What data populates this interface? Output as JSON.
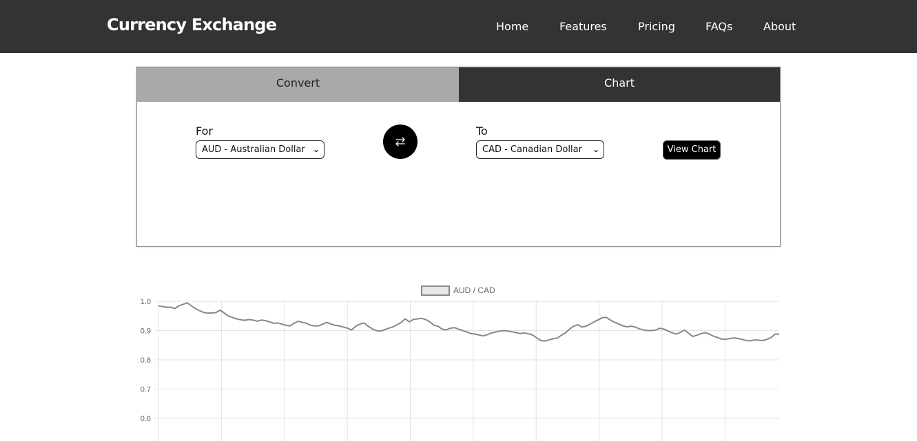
{
  "header": {
    "brand": "Currency Exchange",
    "nav": [
      {
        "label": "Home"
      },
      {
        "label": "Features"
      },
      {
        "label": "Pricing"
      },
      {
        "label": "FAQs"
      },
      {
        "label": "About"
      }
    ]
  },
  "converter": {
    "tabs": {
      "convert": "Convert",
      "chart": "Chart"
    },
    "active_tab": "Chart",
    "from_label": "For",
    "from_value": "AUD - Australian Dollar",
    "to_label": "To",
    "to_value": "CAD - Canadian Dollar",
    "view_button": "View Chart",
    "swap_icon": "swap-arrows-icon"
  },
  "colors": {
    "header_bg": "#333333",
    "tab_inactive": "#a9a9a9",
    "tab_active": "#333333",
    "line": "#888888"
  },
  "chart_data": {
    "type": "line",
    "series": [
      {
        "name": "AUD / CAD",
        "values": [
          0.985,
          0.982,
          0.98,
          0.98,
          0.975,
          0.985,
          0.99,
          0.995,
          0.985,
          0.975,
          0.968,
          0.962,
          0.96,
          0.96,
          0.962,
          0.97,
          0.96,
          0.95,
          0.945,
          0.94,
          0.937,
          0.935,
          0.938,
          0.936,
          0.932,
          0.936,
          0.934,
          0.93,
          0.925,
          0.926,
          0.922,
          0.918,
          0.916,
          0.925,
          0.932,
          0.928,
          0.925,
          0.918,
          0.916,
          0.916,
          0.922,
          0.928,
          0.922,
          0.918,
          0.916,
          0.912,
          0.908,
          0.902,
          0.915,
          0.922,
          0.926,
          0.915,
          0.906,
          0.9,
          0.898,
          0.903,
          0.908,
          0.912,
          0.92,
          0.927,
          0.94,
          0.93,
          0.938,
          0.94,
          0.942,
          0.938,
          0.93,
          0.918,
          0.915,
          0.905,
          0.902,
          0.908,
          0.91,
          0.905,
          0.9,
          0.895,
          0.89,
          0.888,
          0.885,
          0.882,
          0.886,
          0.892,
          0.895,
          0.898,
          0.9,
          0.898,
          0.896,
          0.893,
          0.89,
          0.892,
          0.889,
          0.885,
          0.875,
          0.866,
          0.864,
          0.868,
          0.872,
          0.874,
          0.884,
          0.892,
          0.905,
          0.915,
          0.92,
          0.912,
          0.915,
          0.922,
          0.93,
          0.937,
          0.944,
          0.945,
          0.935,
          0.928,
          0.922,
          0.916,
          0.913,
          0.915,
          0.912,
          0.906,
          0.902,
          0.9,
          0.9,
          0.902,
          0.908,
          0.905,
          0.898,
          0.892,
          0.888,
          0.894,
          0.902,
          0.89,
          0.88,
          0.884,
          0.89,
          0.893,
          0.888,
          0.881,
          0.876,
          0.871,
          0.87,
          0.873,
          0.875,
          0.873,
          0.87,
          0.866,
          0.865,
          0.868,
          0.867,
          0.866,
          0.87,
          0.876,
          0.888,
          0.888
        ]
      }
    ],
    "legend": "top-center",
    "ylim": [
      0.5,
      1.0
    ],
    "yticks": [
      1.0,
      0.9,
      0.8,
      0.7,
      0.6
    ],
    "ytick_labels": [
      "1.0",
      "0.9",
      "0.8",
      "0.7",
      "0.6"
    ],
    "grid": true,
    "title": "",
    "xlabel": "",
    "ylabel": ""
  }
}
